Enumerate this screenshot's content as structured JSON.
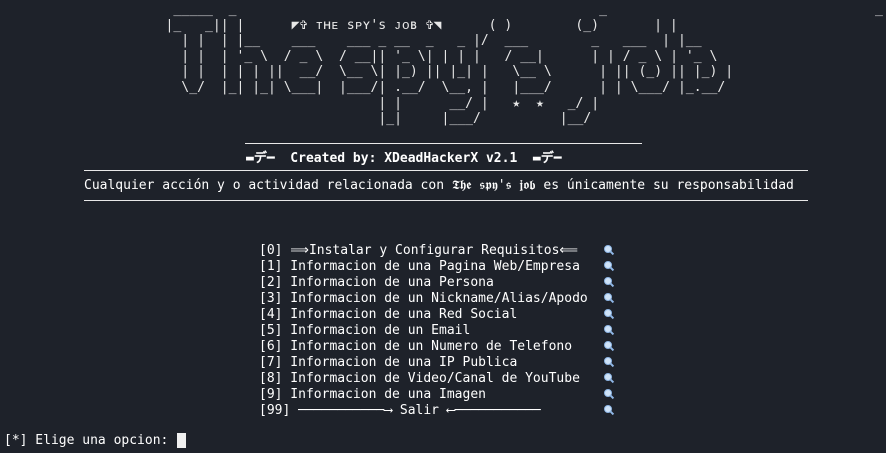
{
  "banner": {
    "ascii_art": [
      "                      _____  _                                              _                                  _",
      "                     |_   _|| |      ◤✞ ᴛʜᴇ sᴘʏ's ᴊᴏʙ ✞◥      ( )        (_)       | |",
      "                       | |  | |__    ___    ___ _ __  _   _ |/  ___        _   ___  | |__",
      "                       | |  | '_ \\  / _ \\  / __|| '_ \\| | | |   / __|      | | / _ \\ | '_ \\",
      "                       | |  | | | ||  __/  \\__ \\| |_) || |_| |   \\__ \\      | || (_) || |_) |",
      "                       \\_/  |_| |_| \\___|  |___/| .__/  \\__, |   |___/      | | \\___/ |_.__/",
      "                                                | |      __/ |   ★  ★   _/ |",
      "                                                |_|     |___/          |__/"
    ],
    "subtitle": "◤✞ ᴛʜᴇ sᴘʏ's ᴊᴏʙ ✞◥"
  },
  "credit": {
    "text": "▬デ━  Created by: XDeadHackerX v2.1  ▬デ━"
  },
  "disclaimer": {
    "text": "Cualquier acción y o actividad relacionada con 𝕿𝖍𝖊 𝖘𝖕𝖞'𝖘 𝖏𝖔𝖇 es únicamente su responsabilidad"
  },
  "menu": {
    "items": [
      {
        "label": "[0] ⟹Instalar y Configurar Requisitos⟸",
        "icon": "magnifier-icon"
      },
      {
        "label": "[1] Informacion de una Pagina Web/Empresa",
        "icon": "magnifier-icon"
      },
      {
        "label": "[2] Informacion de una Persona",
        "icon": "magnifier-icon"
      },
      {
        "label": "[3] Informacion de un Nickname/Alias/Apodo",
        "icon": "magnifier-icon"
      },
      {
        "label": "[4] Informacion de una Red Social",
        "icon": "magnifier-icon"
      },
      {
        "label": "[5] Informacion de un Email",
        "icon": "magnifier-icon"
      },
      {
        "label": "[6] Informacion de un Numero de Telefono",
        "icon": "magnifier-icon"
      },
      {
        "label": "[7] Informacion de una IP Publica",
        "icon": "magnifier-icon"
      },
      {
        "label": "[8] Informacion de Video/Canal de YouTube",
        "icon": "magnifier-icon"
      },
      {
        "label": "[9] Informacion de una Imagen",
        "icon": "magnifier-icon"
      },
      {
        "label": "[99] ───────────⟶ Salir ⟵───────────",
        "icon": "magnifier-icon"
      }
    ]
  },
  "prompt": {
    "text": "[*] Elige una opcion: "
  },
  "colors": {
    "background": "#1e222a",
    "foreground": "#e8e8e8",
    "icon_accent": "#8fb7e6"
  }
}
